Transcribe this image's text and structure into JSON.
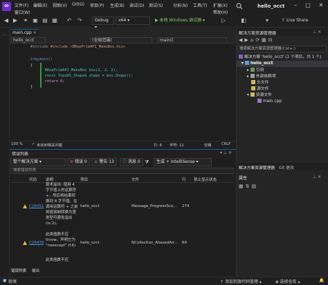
{
  "menu": {
    "file": "文件(F)",
    "edit": "编辑(E)",
    "view": "视图(V)",
    "git": "Git(G)",
    "project": "项目(P)",
    "build": "生成(B)",
    "debug": "调试(D)",
    "test": "测试(S)",
    "analyze": "分析(N)",
    "tools": "工具(T)",
    "extensions": "扩展(X)",
    "window": "窗口(W)",
    "help": "帮助(H)"
  },
  "window": {
    "title": "hello_occt"
  },
  "toolbar": {
    "config": "Debug",
    "platform": "x64",
    "run_label": "▶ 本地 Windows 调试器 ▾",
    "live_share": "Live Share"
  },
  "editor": {
    "tab_label": "main.cpp",
    "nav_project": "hello_occt",
    "nav_scope": "(全局范围)",
    "nav_function": "main()",
    "lines": [
      "#include <BRepPrimAPI_MakeBox.hxx>",
      "",
      "int main()",
      "{",
      "    BRepPrimAPI_MakeBox box(2, 2, 2);",
      "    const TopoDS_Shape& shape = box.Shape();",
      "    return 0;",
      "}"
    ],
    "status": {
      "zoom": "100 %",
      "issues": "未找到相关问题",
      "line": "行: 6",
      "char": "字符: 12",
      "space": "空格",
      "eol": "CRLF"
    }
  },
  "error_list": {
    "title": "错误列表",
    "scope": "整个解决方案",
    "errors": "错误 0",
    "warnings": "警告 13",
    "messages": "消息 0",
    "build_filter": "生成 + IntelliSense",
    "search_placeholder": "搜索错误列表",
    "columns": [
      "代码",
      "说明",
      "项目",
      "文件",
      "行",
      "禁止显示状态"
    ],
    "rows": [
      {
        "code": "C26451",
        "description": "算术溢出: 使用 4 字节值上的运算符 +，然后将结果转换到 8 字节值。在调用运算符 + 之前将值强制转换为宽类型可避免溢出(io.2)。",
        "project": "hello_occt",
        "file": "Message_ProgressSco...",
        "line": "274"
      },
      {
        "code": "C26439",
        "description": "此类函数不应 throw。声明它为 \"noexcept\" (f.6)",
        "project": "hello_occt",
        "file": "NCollection_AliasedArr...",
        "line": "69"
      },
      {
        "code": "",
        "description": "此类函数不应",
        "project": "",
        "file": "",
        "line": ""
      }
    ],
    "bottom_tab_errors": "错误列表",
    "bottom_tab_output": "输出"
  },
  "solution_explorer": {
    "title": "解决方案资源管理器",
    "search": "搜索解决方案资源管理器(Ctrl+;)",
    "solution": "解决方案 'hello_occt' (1 个项目，共 1 个)",
    "project": "hello_occt",
    "items": [
      "引用",
      "外部依赖项",
      "头文件",
      "源文件",
      "资源文件",
      "main.cpp"
    ],
    "tab_solution": "解决方案资源管理器",
    "tab_git": "Git 更改",
    "properties_title": "属性"
  },
  "statusbar": {
    "ready": "就绪",
    "source_control": "添加到源代码管理",
    "repo": "选择仓库"
  },
  "colors": {
    "accent": "#0e639c",
    "warning": "#e9b937",
    "link": "#4e9ee6",
    "logo": "#6c2bd9"
  }
}
